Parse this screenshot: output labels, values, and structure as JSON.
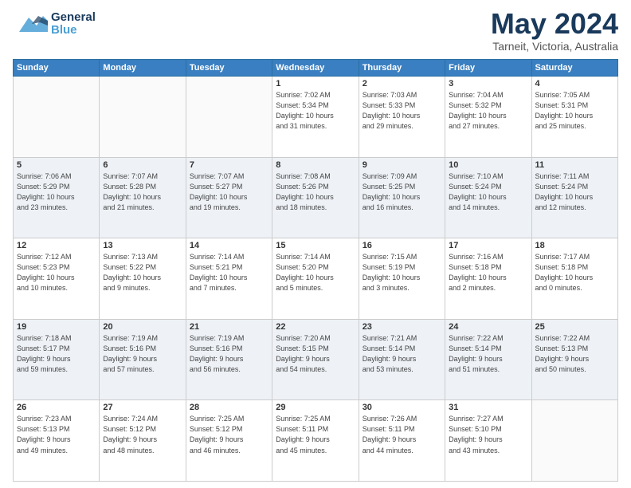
{
  "header": {
    "logo": {
      "general": "General",
      "blue": "Blue"
    },
    "title": "May 2024",
    "location": "Tarneit, Victoria, Australia"
  },
  "weekdays": [
    "Sunday",
    "Monday",
    "Tuesday",
    "Wednesday",
    "Thursday",
    "Friday",
    "Saturday"
  ],
  "weeks": [
    [
      {
        "day": "",
        "info": ""
      },
      {
        "day": "",
        "info": ""
      },
      {
        "day": "",
        "info": ""
      },
      {
        "day": "1",
        "info": "Sunrise: 7:02 AM\nSunset: 5:34 PM\nDaylight: 10 hours\nand 31 minutes."
      },
      {
        "day": "2",
        "info": "Sunrise: 7:03 AM\nSunset: 5:33 PM\nDaylight: 10 hours\nand 29 minutes."
      },
      {
        "day": "3",
        "info": "Sunrise: 7:04 AM\nSunset: 5:32 PM\nDaylight: 10 hours\nand 27 minutes."
      },
      {
        "day": "4",
        "info": "Sunrise: 7:05 AM\nSunset: 5:31 PM\nDaylight: 10 hours\nand 25 minutes."
      }
    ],
    [
      {
        "day": "5",
        "info": "Sunrise: 7:06 AM\nSunset: 5:29 PM\nDaylight: 10 hours\nand 23 minutes."
      },
      {
        "day": "6",
        "info": "Sunrise: 7:07 AM\nSunset: 5:28 PM\nDaylight: 10 hours\nand 21 minutes."
      },
      {
        "day": "7",
        "info": "Sunrise: 7:07 AM\nSunset: 5:27 PM\nDaylight: 10 hours\nand 19 minutes."
      },
      {
        "day": "8",
        "info": "Sunrise: 7:08 AM\nSunset: 5:26 PM\nDaylight: 10 hours\nand 18 minutes."
      },
      {
        "day": "9",
        "info": "Sunrise: 7:09 AM\nSunset: 5:25 PM\nDaylight: 10 hours\nand 16 minutes."
      },
      {
        "day": "10",
        "info": "Sunrise: 7:10 AM\nSunset: 5:24 PM\nDaylight: 10 hours\nand 14 minutes."
      },
      {
        "day": "11",
        "info": "Sunrise: 7:11 AM\nSunset: 5:24 PM\nDaylight: 10 hours\nand 12 minutes."
      }
    ],
    [
      {
        "day": "12",
        "info": "Sunrise: 7:12 AM\nSunset: 5:23 PM\nDaylight: 10 hours\nand 10 minutes."
      },
      {
        "day": "13",
        "info": "Sunrise: 7:13 AM\nSunset: 5:22 PM\nDaylight: 10 hours\nand 9 minutes."
      },
      {
        "day": "14",
        "info": "Sunrise: 7:14 AM\nSunset: 5:21 PM\nDaylight: 10 hours\nand 7 minutes."
      },
      {
        "day": "15",
        "info": "Sunrise: 7:14 AM\nSunset: 5:20 PM\nDaylight: 10 hours\nand 5 minutes."
      },
      {
        "day": "16",
        "info": "Sunrise: 7:15 AM\nSunset: 5:19 PM\nDaylight: 10 hours\nand 3 minutes."
      },
      {
        "day": "17",
        "info": "Sunrise: 7:16 AM\nSunset: 5:18 PM\nDaylight: 10 hours\nand 2 minutes."
      },
      {
        "day": "18",
        "info": "Sunrise: 7:17 AM\nSunset: 5:18 PM\nDaylight: 10 hours\nand 0 minutes."
      }
    ],
    [
      {
        "day": "19",
        "info": "Sunrise: 7:18 AM\nSunset: 5:17 PM\nDaylight: 9 hours\nand 59 minutes."
      },
      {
        "day": "20",
        "info": "Sunrise: 7:19 AM\nSunset: 5:16 PM\nDaylight: 9 hours\nand 57 minutes."
      },
      {
        "day": "21",
        "info": "Sunrise: 7:19 AM\nSunset: 5:16 PM\nDaylight: 9 hours\nand 56 minutes."
      },
      {
        "day": "22",
        "info": "Sunrise: 7:20 AM\nSunset: 5:15 PM\nDaylight: 9 hours\nand 54 minutes."
      },
      {
        "day": "23",
        "info": "Sunrise: 7:21 AM\nSunset: 5:14 PM\nDaylight: 9 hours\nand 53 minutes."
      },
      {
        "day": "24",
        "info": "Sunrise: 7:22 AM\nSunset: 5:14 PM\nDaylight: 9 hours\nand 51 minutes."
      },
      {
        "day": "25",
        "info": "Sunrise: 7:22 AM\nSunset: 5:13 PM\nDaylight: 9 hours\nand 50 minutes."
      }
    ],
    [
      {
        "day": "26",
        "info": "Sunrise: 7:23 AM\nSunset: 5:13 PM\nDaylight: 9 hours\nand 49 minutes."
      },
      {
        "day": "27",
        "info": "Sunrise: 7:24 AM\nSunset: 5:12 PM\nDaylight: 9 hours\nand 48 minutes."
      },
      {
        "day": "28",
        "info": "Sunrise: 7:25 AM\nSunset: 5:12 PM\nDaylight: 9 hours\nand 46 minutes."
      },
      {
        "day": "29",
        "info": "Sunrise: 7:25 AM\nSunset: 5:11 PM\nDaylight: 9 hours\nand 45 minutes."
      },
      {
        "day": "30",
        "info": "Sunrise: 7:26 AM\nSunset: 5:11 PM\nDaylight: 9 hours\nand 44 minutes."
      },
      {
        "day": "31",
        "info": "Sunrise: 7:27 AM\nSunset: 5:10 PM\nDaylight: 9 hours\nand 43 minutes."
      },
      {
        "day": "",
        "info": ""
      }
    ]
  ]
}
